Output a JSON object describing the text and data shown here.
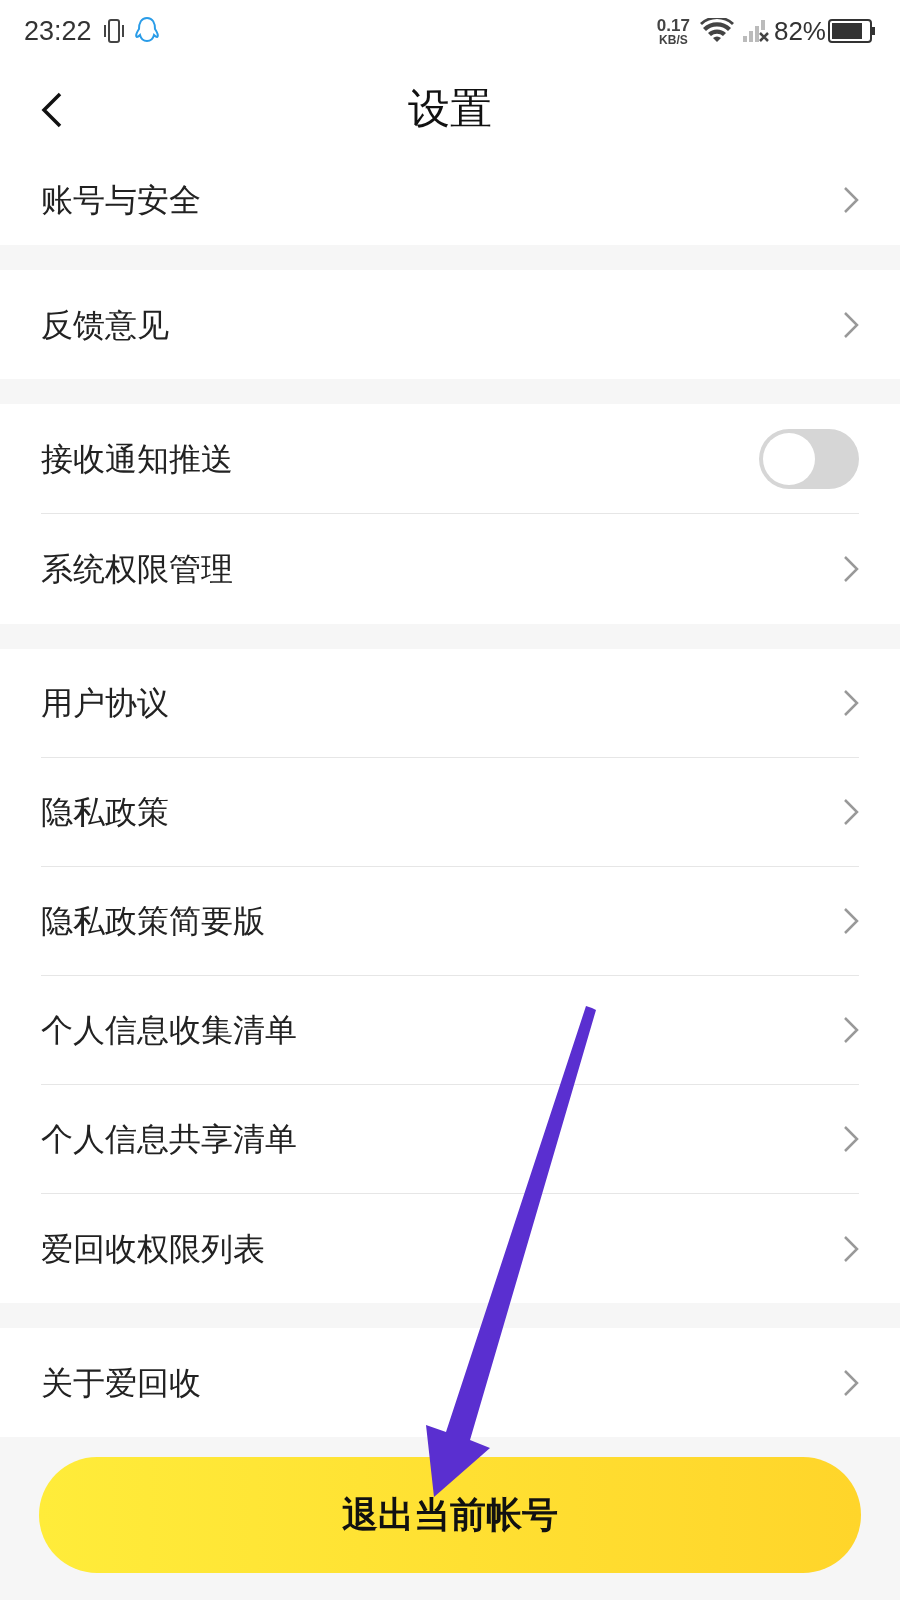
{
  "status_bar": {
    "time": "23:22",
    "net_speed": "0.17",
    "net_unit": "KB/S",
    "battery": "82%"
  },
  "header": {
    "title": "设置"
  },
  "sections": [
    {
      "items": [
        {
          "kind": "link",
          "label": "账号与安全"
        }
      ]
    },
    {
      "items": [
        {
          "kind": "link",
          "label": "反馈意见"
        }
      ]
    },
    {
      "items": [
        {
          "kind": "toggle",
          "label": "接收通知推送",
          "on": false
        },
        {
          "kind": "link",
          "label": "系统权限管理"
        }
      ]
    },
    {
      "items": [
        {
          "kind": "link",
          "label": "用户协议"
        },
        {
          "kind": "link",
          "label": "隐私政策"
        },
        {
          "kind": "link",
          "label": "隐私政策简要版"
        },
        {
          "kind": "link",
          "label": "个人信息收集清单"
        },
        {
          "kind": "link",
          "label": "个人信息共享清单"
        },
        {
          "kind": "link",
          "label": "爱回收权限列表"
        }
      ]
    },
    {
      "items": [
        {
          "kind": "link",
          "label": "关于爱回收"
        }
      ]
    }
  ],
  "logout_button": "退出当前帐号"
}
